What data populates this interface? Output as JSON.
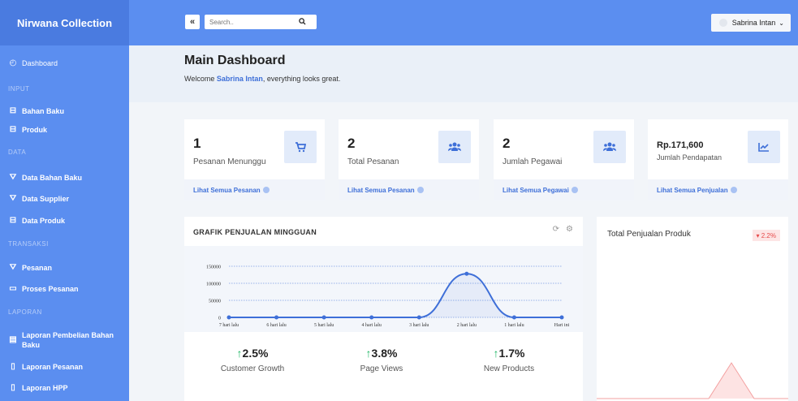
{
  "brand": "Nirwana Collection",
  "sidebar": {
    "dashboard": "Dashboard",
    "sections": {
      "input": "INPUT",
      "data": "DATA",
      "transaksi": "TRANSAKSI",
      "laporan": "LAPORAN"
    },
    "items": {
      "bahan_baku": "Bahan Baku",
      "produk": "Produk",
      "data_bahan_baku": "Data Bahan Baku",
      "data_supplier": "Data Supplier",
      "data_produk": "Data Produk",
      "pesanan": "Pesanan",
      "proses_pesanan": "Proses Pesanan",
      "laporan_pembelian_1": "Laporan Pembelian Bahan",
      "laporan_pembelian_2": "Baku",
      "laporan_pesanan": "Laporan Pesanan",
      "laporan_hpp": "Laporan HPP"
    }
  },
  "topbar": {
    "toggle": "«",
    "search_placeholder": "Search..",
    "user_name": "Sabrina Intan"
  },
  "header": {
    "title": "Main Dashboard",
    "welcome_prefix": "Welcome ",
    "welcome_name": "Sabrina Intan",
    "welcome_suffix": ", everything looks great."
  },
  "cards": [
    {
      "value": "1",
      "label": "Pesanan Menunggu",
      "link": "Lihat Semua Pesanan",
      "icon": "cart-icon"
    },
    {
      "value": "2",
      "label": "Total Pesanan",
      "link": "Lihat Semua Pesanan",
      "icon": "users-icon"
    },
    {
      "value": "2",
      "label": "Jumlah Pegawai",
      "link": "Lihat Semua Pegawai",
      "icon": "users-icon"
    },
    {
      "value": "Rp.171,600",
      "label": "Jumlah Pendapatan",
      "link": "Lihat Semua Penjualan",
      "icon": "trend-icon"
    }
  ],
  "chart_panel": {
    "title": "GRAFIK PENJUALAN MINGGUAN"
  },
  "chart_data": {
    "type": "line",
    "title": "GRAFIK PENJUALAN MINGGUAN",
    "categories": [
      "7 hari lalu",
      "6 hari lalu",
      "5 hari lalu",
      "4 hari lalu",
      "3 hari lalu",
      "2 hari lalu",
      "1 hari lalu",
      "Hari ini"
    ],
    "values": [
      0,
      0,
      0,
      0,
      0,
      128000,
      0,
      0
    ],
    "yticks": [
      "150000",
      "100000",
      "50000",
      "0"
    ],
    "ylim": [
      0,
      150000
    ],
    "color": "#3e6fd8"
  },
  "metrics": [
    {
      "arrow": "↑",
      "value": "2.5%",
      "label": "Customer Growth"
    },
    {
      "arrow": "↑",
      "value": "3.8%",
      "label": "Page Views"
    },
    {
      "arrow": "↑",
      "value": "1.7%",
      "label": "New Products"
    }
  ],
  "right_panel": {
    "title": "Total Penjualan Produk",
    "badge": "▾ 2.2%"
  }
}
